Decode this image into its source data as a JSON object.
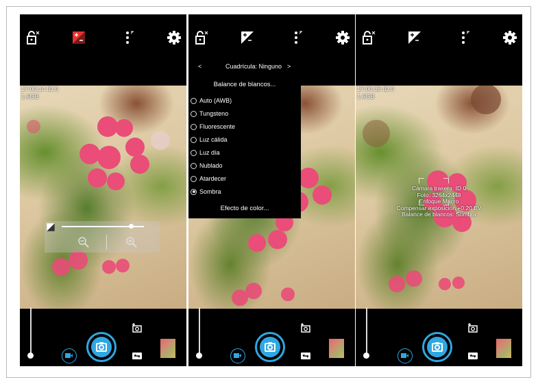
{
  "icons": {
    "lock": "lock-icon",
    "exposure": "exposure-icon",
    "popup": "popup-menu-icon",
    "settings": "gear-icon",
    "zoom_out": "zoom-out-icon",
    "zoom_in": "zoom-in-icon",
    "shutter": "camera-icon",
    "video": "video-icon",
    "switch_camera": "switch-camera-icon",
    "switch_mode": "switch-mode-icon"
  },
  "colors": {
    "accent": "#2fa7e2",
    "exposure_active": "#e8322f",
    "background": "#000000"
  },
  "screen1": {
    "overlay_line1": "17:00:14 ID:0",
    "overlay_line2": "1.6GB",
    "exposure_level": 0.7
  },
  "screen2": {
    "grid_prev": "<",
    "grid_label": "Cuadrícula: Ninguno",
    "grid_next": ">",
    "wb_title": "Balance de blancos...",
    "wb_options": [
      "Auto (AWB)",
      "Tungsteno",
      "Fluorescente",
      "Luz cálida",
      "Luz día",
      "Nublado",
      "Atardecer",
      "Sombra"
    ],
    "wb_selected": "Sombra",
    "color_effect": "Efecto de color..."
  },
  "screen3": {
    "overlay_line1": "17:00:36 ID:0",
    "overlay_line2": "1.6GB",
    "info": [
      "Cámara trasera: ID 0",
      "Foto: 3264x2448",
      "Enfoque Macro",
      "Compensar exposición +0.20 EV",
      "Balance de blancos: Sombra"
    ]
  }
}
